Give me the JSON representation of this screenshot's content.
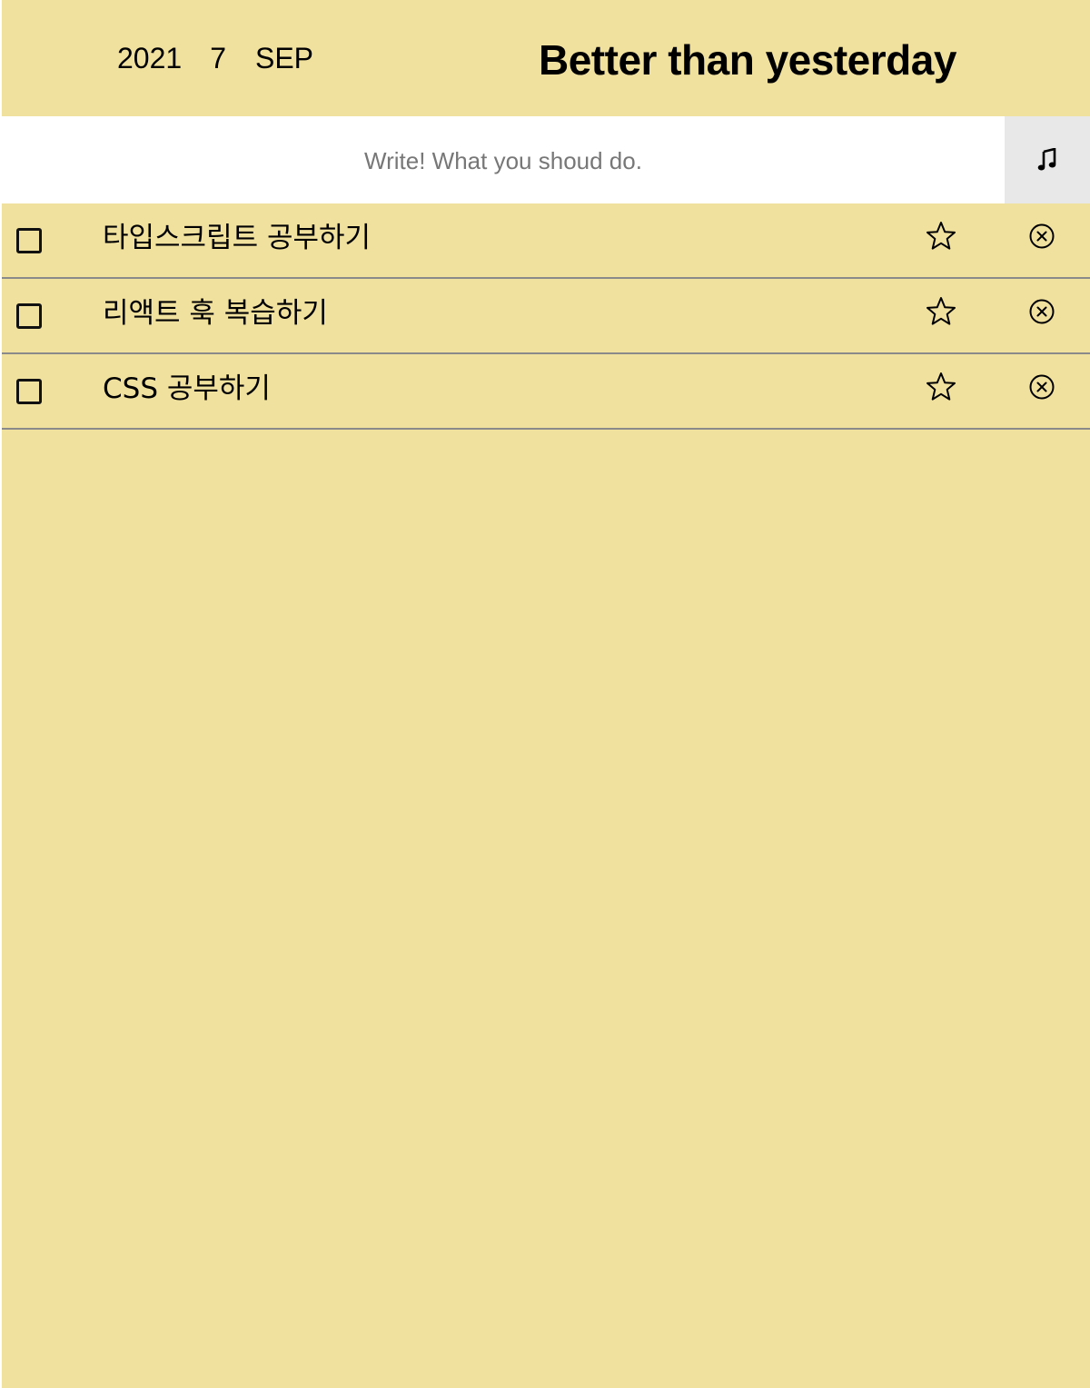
{
  "header": {
    "year": "2021",
    "day": "7",
    "month": "SEP",
    "title": "Better than yesterday"
  },
  "input": {
    "value": "",
    "placeholder": "Write! What you shoud do.",
    "music_icon": "music-note-icon"
  },
  "todos": [
    {
      "text": "타입스크립트 공부하기",
      "checked": false,
      "starred": false
    },
    {
      "text": "리액트 훅 복습하기",
      "checked": false,
      "starred": false
    },
    {
      "text": "CSS 공부하기",
      "checked": false,
      "starred": false
    }
  ],
  "colors": {
    "background": "#f1e19f",
    "input_background": "#ffffff",
    "music_button_background": "#e8e8e8",
    "divider": "#8a8a8a"
  }
}
